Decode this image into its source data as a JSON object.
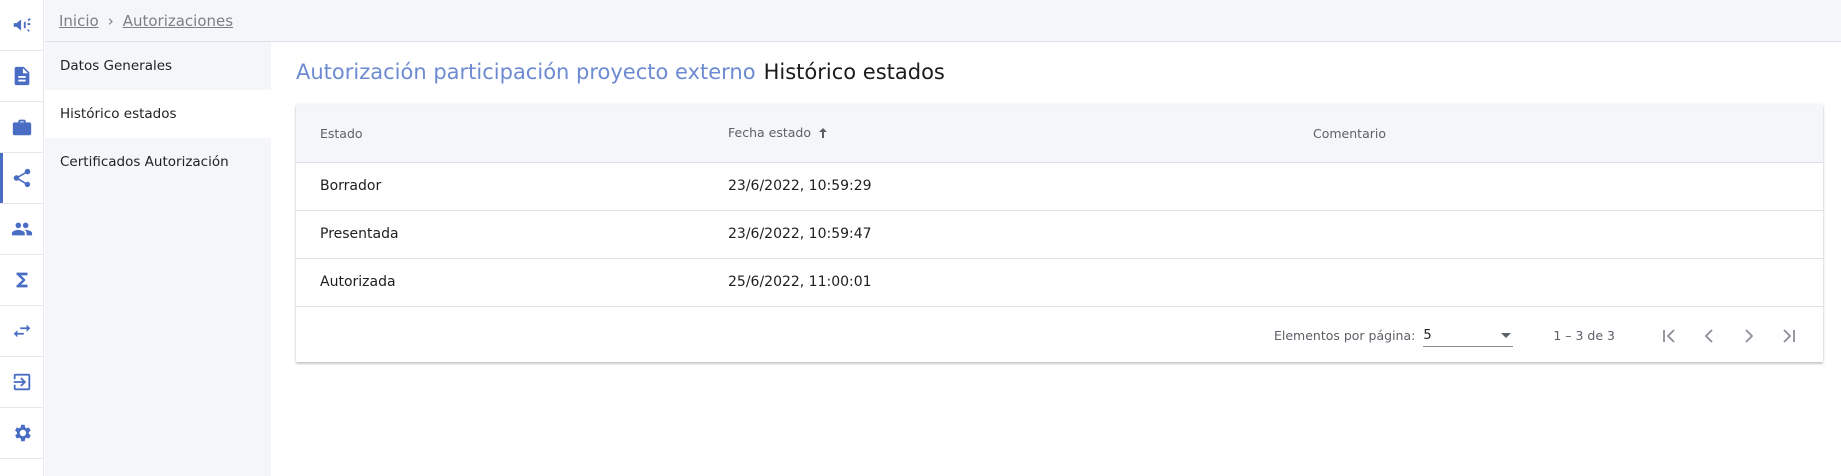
{
  "breadcrumb": {
    "home": "Inicio",
    "separator": "›",
    "current": "Autorizaciones"
  },
  "rail": {
    "items": [
      {
        "icon": "megaphone-icon"
      },
      {
        "icon": "document-icon"
      },
      {
        "icon": "briefcase-icon"
      },
      {
        "icon": "share-icon",
        "active": true
      },
      {
        "icon": "people-icon"
      },
      {
        "icon": "sigma-icon"
      },
      {
        "icon": "swap-icon"
      },
      {
        "icon": "logout-icon"
      },
      {
        "icon": "gear-icon"
      }
    ]
  },
  "sidenav": {
    "items": [
      {
        "label": "Datos Generales"
      },
      {
        "label": "Histórico estados",
        "selected": true
      },
      {
        "label": "Certificados Autorización"
      }
    ]
  },
  "page": {
    "title_entity": "Autorización participación proyecto externo",
    "title_section": "Histórico estados"
  },
  "table": {
    "columns": [
      "Estado",
      "Fecha estado",
      "Comentario"
    ],
    "sorted_column": "Fecha estado",
    "sort_direction": "asc",
    "rows": [
      {
        "estado": "Borrador",
        "fecha": "23/6/2022, 10:59:29",
        "comentario": ""
      },
      {
        "estado": "Presentada",
        "fecha": "23/6/2022, 10:59:47",
        "comentario": ""
      },
      {
        "estado": "Autorizada",
        "fecha": "25/6/2022, 11:00:01",
        "comentario": ""
      }
    ]
  },
  "paginator": {
    "items_per_page_label": "Elementos por página:",
    "items_per_page": "5",
    "range": "1 – 3 de 3"
  },
  "colors": {
    "accent": "#4a6dc4",
    "title_accent": "#6d8bd1",
    "panel_bg": "#f4f6f9"
  }
}
